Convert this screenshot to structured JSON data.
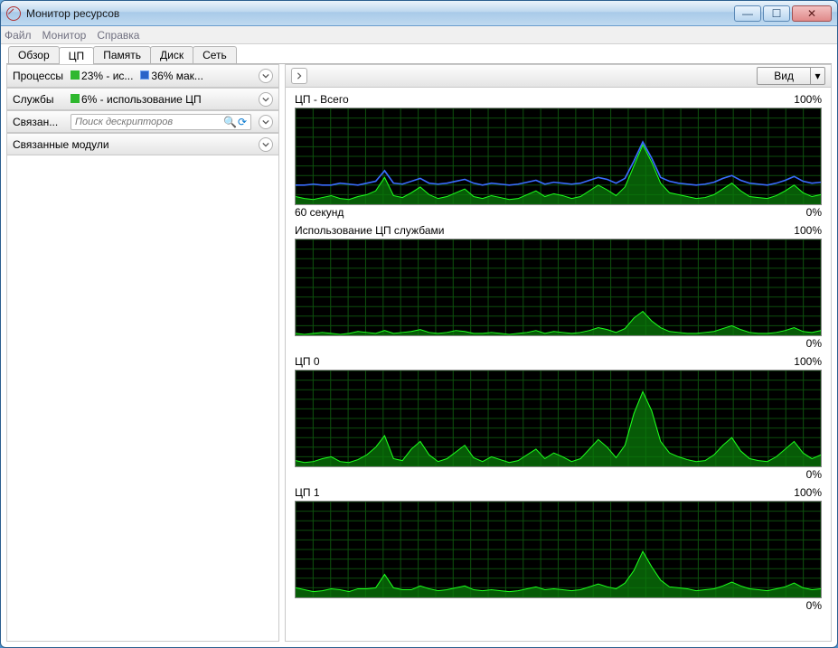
{
  "window": {
    "title": "Монитор ресурсов"
  },
  "menu": {
    "file": "Файл",
    "monitor": "Монитор",
    "help": "Справка"
  },
  "tabs": {
    "overview": "Обзор",
    "cpu": "ЦП",
    "memory": "Память",
    "disk": "Диск",
    "network": "Сеть"
  },
  "panels": {
    "processes": {
      "label": "Процессы",
      "stat1": "23% - ис...",
      "stat2": "36% мак..."
    },
    "services": {
      "label": "Службы",
      "stat": "6% - использование ЦП"
    },
    "handles": {
      "label": "Связан...",
      "placeholder": "Поиск дескрипторов"
    },
    "modules": {
      "label": "Связанные модули"
    }
  },
  "right": {
    "view_button": "Вид"
  },
  "chart_labels": {
    "max": "100%",
    "min": "0%",
    "xleft": "60 секунд"
  },
  "chart_data": [
    {
      "title": "ЦП - Всего",
      "type": "area",
      "grid": {
        "cols": 30,
        "rows": 10
      },
      "x": [
        0,
        1,
        2,
        3,
        4,
        5,
        6,
        7,
        8,
        9,
        10,
        11,
        12,
        13,
        14,
        15,
        16,
        17,
        18,
        19,
        20,
        21,
        22,
        23,
        24,
        25,
        26,
        27,
        28,
        29,
        30,
        31,
        32,
        33,
        34,
        35,
        36,
        37,
        38,
        39,
        40,
        41,
        42,
        43,
        44,
        45,
        46,
        47,
        48,
        49,
        50,
        51,
        52,
        53,
        54,
        55,
        56,
        57,
        58,
        59
      ],
      "series": [
        {
          "name": "usage",
          "color_fill": "#0a7a0a",
          "color_line": "#1dff1d",
          "values": [
            8,
            6,
            5,
            7,
            9,
            6,
            5,
            8,
            10,
            14,
            28,
            9,
            7,
            12,
            18,
            10,
            6,
            8,
            12,
            16,
            8,
            6,
            9,
            7,
            5,
            6,
            10,
            14,
            8,
            11,
            9,
            6,
            8,
            14,
            20,
            15,
            9,
            18,
            40,
            62,
            44,
            22,
            12,
            10,
            8,
            6,
            7,
            10,
            16,
            22,
            14,
            8,
            7,
            6,
            9,
            14,
            20,
            12,
            8,
            10
          ]
        },
        {
          "name": "max_freq",
          "color_line": "#3a6cff",
          "values": [
            20,
            20,
            21,
            20,
            20,
            22,
            21,
            20,
            22,
            24,
            35,
            22,
            21,
            24,
            27,
            22,
            21,
            22,
            24,
            26,
            22,
            20,
            22,
            21,
            20,
            21,
            23,
            25,
            21,
            23,
            22,
            21,
            22,
            25,
            28,
            26,
            22,
            27,
            45,
            65,
            48,
            28,
            24,
            22,
            21,
            20,
            21,
            23,
            27,
            30,
            25,
            22,
            21,
            20,
            22,
            25,
            29,
            24,
            22,
            23
          ]
        }
      ]
    },
    {
      "title": "Использование ЦП службами",
      "type": "area",
      "grid": {
        "cols": 30,
        "rows": 10
      },
      "x_range": 60,
      "series": [
        {
          "name": "services",
          "color_fill": "#0a7a0a",
          "color_line": "#1dff1d",
          "values": [
            2,
            1,
            2,
            3,
            2,
            1,
            2,
            4,
            3,
            2,
            5,
            2,
            3,
            4,
            6,
            3,
            2,
            3,
            5,
            4,
            2,
            2,
            3,
            2,
            1,
            2,
            3,
            5,
            2,
            4,
            3,
            2,
            3,
            5,
            8,
            6,
            3,
            7,
            18,
            25,
            15,
            8,
            4,
            3,
            2,
            2,
            3,
            4,
            7,
            10,
            6,
            3,
            2,
            2,
            3,
            5,
            8,
            4,
            3,
            5
          ]
        }
      ]
    },
    {
      "title": "ЦП 0",
      "type": "area",
      "grid": {
        "cols": 30,
        "rows": 10
      },
      "x_range": 60,
      "series": [
        {
          "name": "cpu0",
          "color_fill": "#0a7a0a",
          "color_line": "#1dff1d",
          "values": [
            6,
            4,
            5,
            8,
            10,
            5,
            4,
            7,
            12,
            20,
            32,
            8,
            6,
            18,
            26,
            12,
            5,
            8,
            15,
            22,
            9,
            5,
            10,
            7,
            4,
            6,
            12,
            18,
            8,
            14,
            10,
            5,
            8,
            18,
            28,
            20,
            9,
            22,
            55,
            78,
            58,
            26,
            14,
            10,
            7,
            5,
            6,
            12,
            22,
            30,
            16,
            8,
            6,
            5,
            10,
            18,
            26,
            14,
            8,
            12
          ]
        }
      ]
    },
    {
      "title": "ЦП 1",
      "type": "area",
      "grid": {
        "cols": 30,
        "rows": 10
      },
      "x_range": 60,
      "series": [
        {
          "name": "cpu1",
          "color_fill": "#0a7a0a",
          "color_line": "#1dff1d",
          "values": [
            10,
            8,
            6,
            7,
            9,
            8,
            6,
            9,
            9,
            10,
            24,
            10,
            8,
            8,
            12,
            9,
            7,
            8,
            10,
            12,
            8,
            7,
            8,
            7,
            6,
            7,
            9,
            11,
            8,
            9,
            8,
            7,
            8,
            11,
            14,
            11,
            9,
            15,
            28,
            48,
            32,
            18,
            11,
            10,
            9,
            7,
            8,
            9,
            12,
            16,
            12,
            9,
            8,
            7,
            9,
            11,
            15,
            10,
            8,
            9
          ]
        }
      ]
    }
  ]
}
